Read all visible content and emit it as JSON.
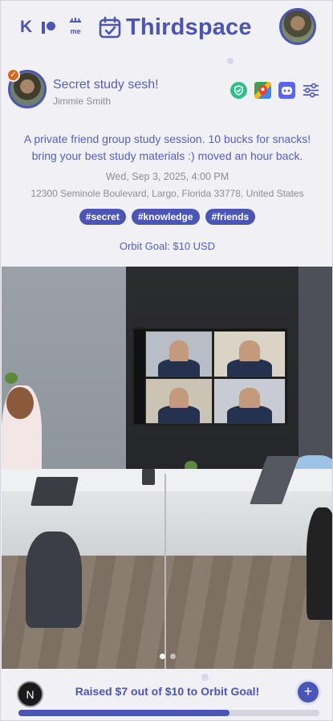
{
  "header": {
    "app_title": "Thirdspace",
    "left_icons": [
      "k-icon",
      "patreon-icon",
      "buymeacoffee-icon"
    ],
    "buymeacoffee_label": "me",
    "k_label": "K"
  },
  "event": {
    "title": "Secret study sesh!",
    "host": "Jimmie Smith",
    "description": "A private friend group study session. 10 bucks for snacks! bring your best study materials :) moved an hour back.",
    "date": "Wed, Sep 3, 2025, 4:00 PM",
    "address": "12300 Seminole Boulevard, Largo, Florida 33778, United States",
    "tags": [
      "#secret",
      "#knowledge",
      "#friends"
    ],
    "orbit_goal": "Orbit Goal: $10 USD",
    "action_icons": [
      "shield-check-icon",
      "google-maps-icon",
      "discord-bot-icon",
      "settings-sliders-icon"
    ]
  },
  "carousel": {
    "total": 2,
    "active_index": 0
  },
  "funding": {
    "avatar_letter": "N",
    "raised_text": "Raised $7 out of $10 to Orbit Goal!",
    "raised": 7,
    "goal": 10,
    "progress_fraction": 0.7,
    "plus_label": "+"
  },
  "colors": {
    "brand": "#4b55b5",
    "background": "#f1f0f4",
    "muted_text": "#8d8d99",
    "verified_badge": "#d26a1f"
  }
}
